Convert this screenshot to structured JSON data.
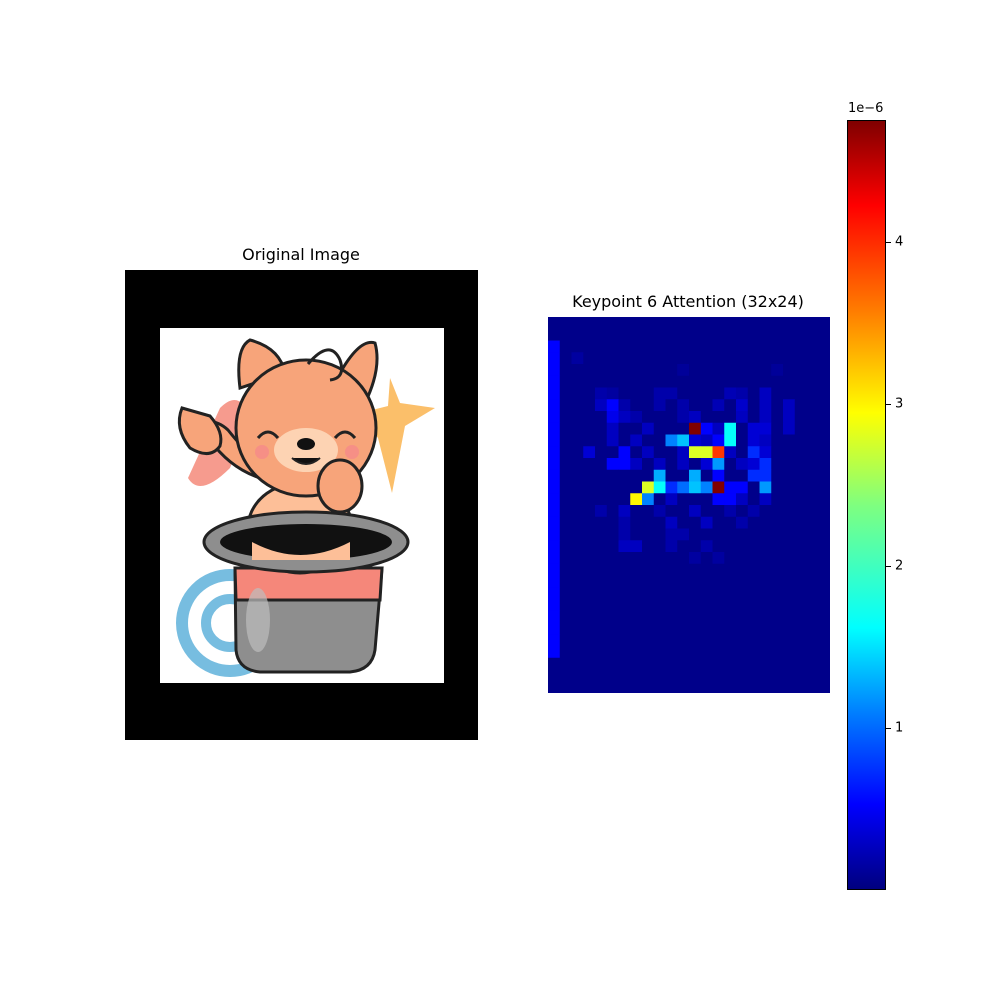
{
  "left_panel": {
    "title": "Original Image"
  },
  "chart_data": {
    "type": "heatmap",
    "title": "Keypoint 6 Attention (32x24)",
    "rows": 32,
    "cols": 24,
    "colormap": "jet",
    "value_multiplier": 1e-06,
    "vmin": 0.0,
    "vmax": 4.75,
    "colorbar_exponent_label": "1e−6",
    "colorbar_ticks": [
      "1",
      "2",
      "3",
      "4"
    ],
    "colorbar_tick_values": [
      1,
      2,
      3,
      4
    ],
    "default_value": 0.05,
    "cells": [
      [
        2,
        0,
        0.6
      ],
      [
        3,
        0,
        0.6
      ],
      [
        4,
        0,
        0.6
      ],
      [
        5,
        0,
        0.6
      ],
      [
        6,
        0,
        0.6
      ],
      [
        7,
        0,
        0.6
      ],
      [
        8,
        0,
        0.6
      ],
      [
        9,
        0,
        0.6
      ],
      [
        10,
        0,
        0.6
      ],
      [
        11,
        0,
        0.6
      ],
      [
        12,
        0,
        0.6
      ],
      [
        13,
        0,
        0.6
      ],
      [
        14,
        0,
        0.6
      ],
      [
        15,
        0,
        0.6
      ],
      [
        16,
        0,
        0.6
      ],
      [
        17,
        0,
        0.6
      ],
      [
        18,
        0,
        0.6
      ],
      [
        19,
        0,
        0.6
      ],
      [
        20,
        0,
        0.6
      ],
      [
        21,
        0,
        0.6
      ],
      [
        22,
        0,
        0.6
      ],
      [
        23,
        0,
        0.6
      ],
      [
        24,
        0,
        0.6
      ],
      [
        25,
        0,
        0.6
      ],
      [
        26,
        0,
        0.6
      ],
      [
        27,
        0,
        0.6
      ],
      [
        28,
        0,
        0.6
      ],
      [
        3,
        2,
        0.15
      ],
      [
        4,
        11,
        0.12
      ],
      [
        4,
        19,
        0.12
      ],
      [
        6,
        4,
        0.2
      ],
      [
        6,
        5,
        0.15
      ],
      [
        6,
        9,
        0.2
      ],
      [
        6,
        10,
        0.2
      ],
      [
        6,
        15,
        0.25
      ],
      [
        6,
        16,
        0.2
      ],
      [
        6,
        18,
        0.3
      ],
      [
        7,
        4,
        0.3
      ],
      [
        7,
        5,
        0.6
      ],
      [
        7,
        6,
        0.2
      ],
      [
        7,
        9,
        0.2
      ],
      [
        7,
        11,
        0.2
      ],
      [
        7,
        14,
        0.25
      ],
      [
        7,
        16,
        0.35
      ],
      [
        7,
        18,
        0.3
      ],
      [
        7,
        20,
        0.3
      ],
      [
        8,
        5,
        0.5
      ],
      [
        8,
        6,
        0.3
      ],
      [
        8,
        7,
        0.2
      ],
      [
        8,
        11,
        0.2
      ],
      [
        8,
        12,
        0.3
      ],
      [
        8,
        16,
        0.3
      ],
      [
        8,
        18,
        0.3
      ],
      [
        8,
        20,
        0.3
      ],
      [
        9,
        5,
        0.3
      ],
      [
        9,
        8,
        0.3
      ],
      [
        9,
        12,
        4.75
      ],
      [
        9,
        13,
        0.6
      ],
      [
        9,
        14,
        0.3
      ],
      [
        9,
        15,
        1.8
      ],
      [
        9,
        17,
        0.4
      ],
      [
        9,
        18,
        0.4
      ],
      [
        9,
        20,
        0.3
      ],
      [
        10,
        5,
        0.3
      ],
      [
        10,
        7,
        0.3
      ],
      [
        10,
        10,
        1.2
      ],
      [
        10,
        11,
        1.5
      ],
      [
        10,
        12,
        0.4
      ],
      [
        10,
        13,
        0.3
      ],
      [
        10,
        14,
        0.6
      ],
      [
        10,
        15,
        1.8
      ],
      [
        10,
        17,
        0.4
      ],
      [
        10,
        18,
        0.3
      ],
      [
        11,
        3,
        0.4
      ],
      [
        11,
        6,
        0.6
      ],
      [
        11,
        8,
        0.3
      ],
      [
        11,
        11,
        0.3
      ],
      [
        11,
        12,
        2.8
      ],
      [
        11,
        13,
        2.8
      ],
      [
        11,
        14,
        3.9
      ],
      [
        11,
        15,
        0.3
      ],
      [
        11,
        17,
        0.8
      ],
      [
        11,
        18,
        0.4
      ],
      [
        12,
        5,
        0.6
      ],
      [
        12,
        6,
        0.6
      ],
      [
        12,
        7,
        0.3
      ],
      [
        12,
        9,
        0.3
      ],
      [
        12,
        11,
        0.3
      ],
      [
        12,
        13,
        0.4
      ],
      [
        12,
        14,
        1.3
      ],
      [
        12,
        16,
        0.3
      ],
      [
        12,
        17,
        0.4
      ],
      [
        12,
        18,
        0.8
      ],
      [
        13,
        9,
        1.4
      ],
      [
        13,
        12,
        1.4
      ],
      [
        13,
        14,
        0.6
      ],
      [
        13,
        17,
        0.8
      ],
      [
        13,
        18,
        0.8
      ],
      [
        14,
        8,
        2.8
      ],
      [
        14,
        9,
        1.8
      ],
      [
        14,
        10,
        0.8
      ],
      [
        14,
        11,
        1.1
      ],
      [
        14,
        12,
        1.5
      ],
      [
        14,
        13,
        1.2
      ],
      [
        14,
        14,
        4.75
      ],
      [
        14,
        15,
        0.6
      ],
      [
        14,
        16,
        0.6
      ],
      [
        14,
        18,
        1.3
      ],
      [
        15,
        7,
        3.0
      ],
      [
        15,
        8,
        1.2
      ],
      [
        15,
        10,
        0.3
      ],
      [
        15,
        14,
        0.6
      ],
      [
        15,
        15,
        0.6
      ],
      [
        15,
        16,
        0.3
      ],
      [
        15,
        18,
        0.3
      ],
      [
        16,
        4,
        0.2
      ],
      [
        16,
        6,
        0.3
      ],
      [
        16,
        9,
        0.2
      ],
      [
        16,
        12,
        0.3
      ],
      [
        16,
        15,
        0.2
      ],
      [
        16,
        17,
        0.2
      ],
      [
        17,
        6,
        0.2
      ],
      [
        17,
        10,
        0.3
      ],
      [
        17,
        13,
        0.3
      ],
      [
        17,
        16,
        0.2
      ],
      [
        18,
        6,
        0.2
      ],
      [
        18,
        10,
        0.2
      ],
      [
        18,
        11,
        0.2
      ],
      [
        19,
        6,
        0.3
      ],
      [
        19,
        7,
        0.3
      ],
      [
        19,
        10,
        0.2
      ],
      [
        19,
        13,
        0.2
      ],
      [
        20,
        12,
        0.15
      ],
      [
        20,
        14,
        0.15
      ]
    ]
  }
}
